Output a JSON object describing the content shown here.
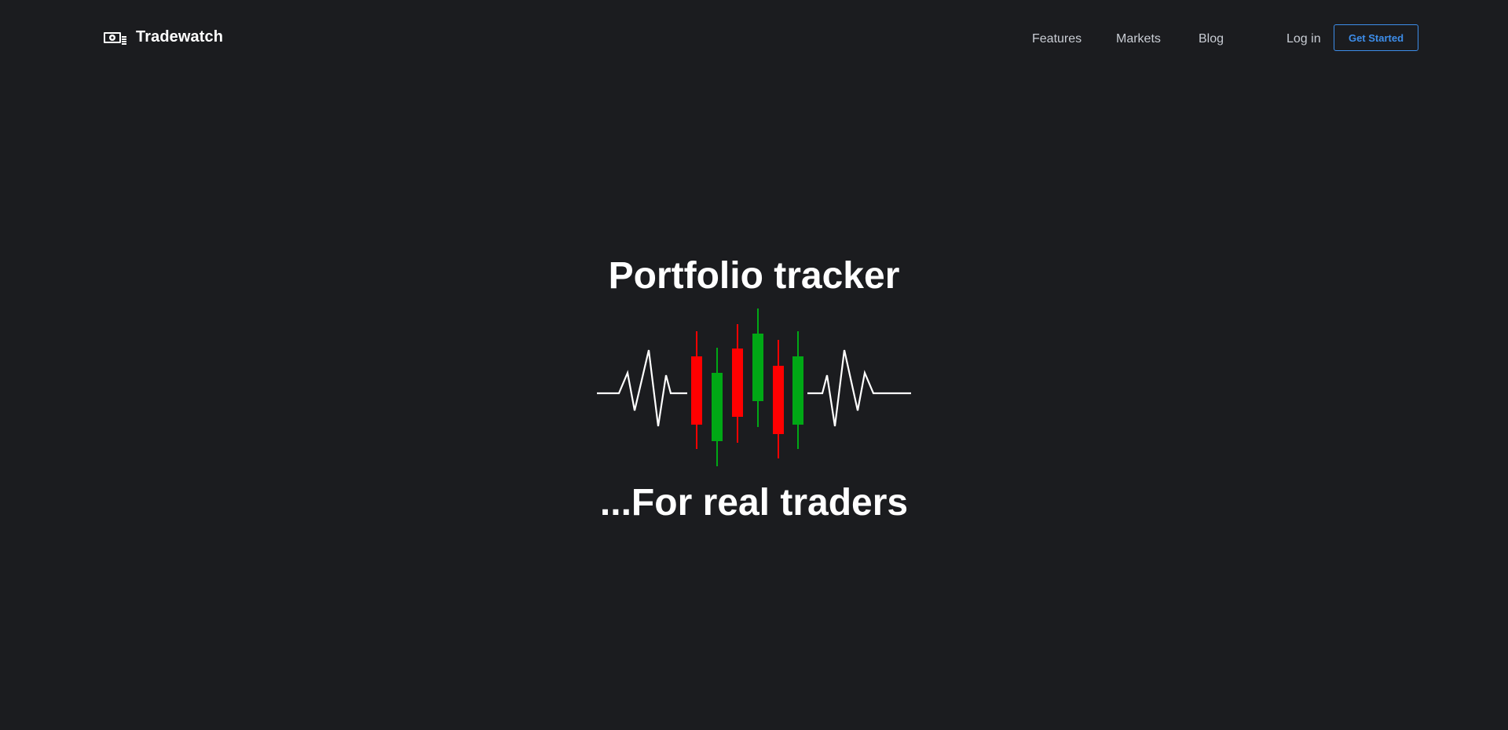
{
  "brand": {
    "name": "Tradewatch",
    "icon": "money-icon"
  },
  "nav": {
    "features": "Features",
    "markets": "Markets",
    "blog": "Blog",
    "login": "Log in",
    "get_started": "Get Started"
  },
  "hero": {
    "title": "Portfolio tracker",
    "subtitle": "...For real traders",
    "art_icon": "candlestick-heartbeat-icon"
  },
  "colors": {
    "background": "#1b1c1f",
    "accent": "#3d8de9",
    "candle_up": "#00a815",
    "candle_down": "#ff0000",
    "pulse_line": "#ffffff"
  }
}
